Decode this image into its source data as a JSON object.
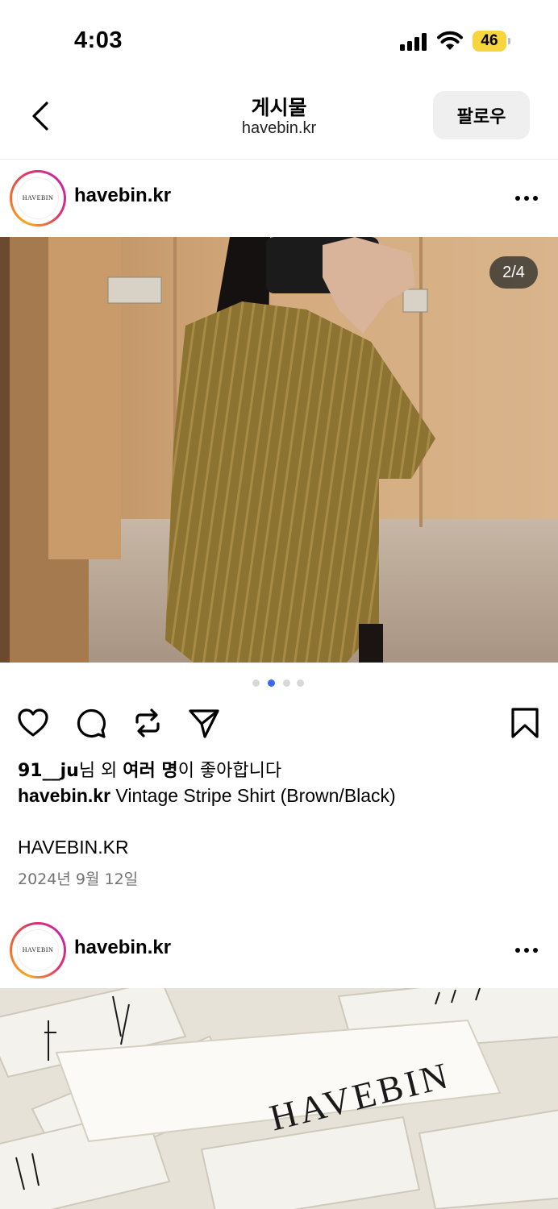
{
  "status_bar": {
    "time": "4:03",
    "battery": "46"
  },
  "header": {
    "title": "게시물",
    "subtitle": "havebin.kr",
    "follow_label": "팔로우"
  },
  "post1": {
    "username": "havebin.kr",
    "avatar_text": "HAVEBIN",
    "image_counter": "2/4",
    "carousel": {
      "total": 4,
      "active": 2
    },
    "likes": {
      "user": "91__ju",
      "middle": "님 외 ",
      "bold": "여러 명",
      "suffix": "이 좋아합니다"
    },
    "caption": {
      "user": "havebin.kr",
      "text": " Vintage Stripe Shirt (Brown/Black)"
    },
    "caption_extra": "HAVEBIN.KR",
    "date": "2024년 9월 12일"
  },
  "post2": {
    "username": "havebin.kr",
    "avatar_text": "HAVEBIN",
    "label_text": "HAVEBIN"
  },
  "colors": {
    "accent": "#3a67f5",
    "battery": "#f6d53e",
    "date_gray": "#737373"
  },
  "icons": [
    "back-icon",
    "more-icon",
    "heart-icon",
    "comment-icon",
    "repost-icon",
    "share-icon",
    "bookmark-icon",
    "signal-icon",
    "wifi-icon"
  ]
}
